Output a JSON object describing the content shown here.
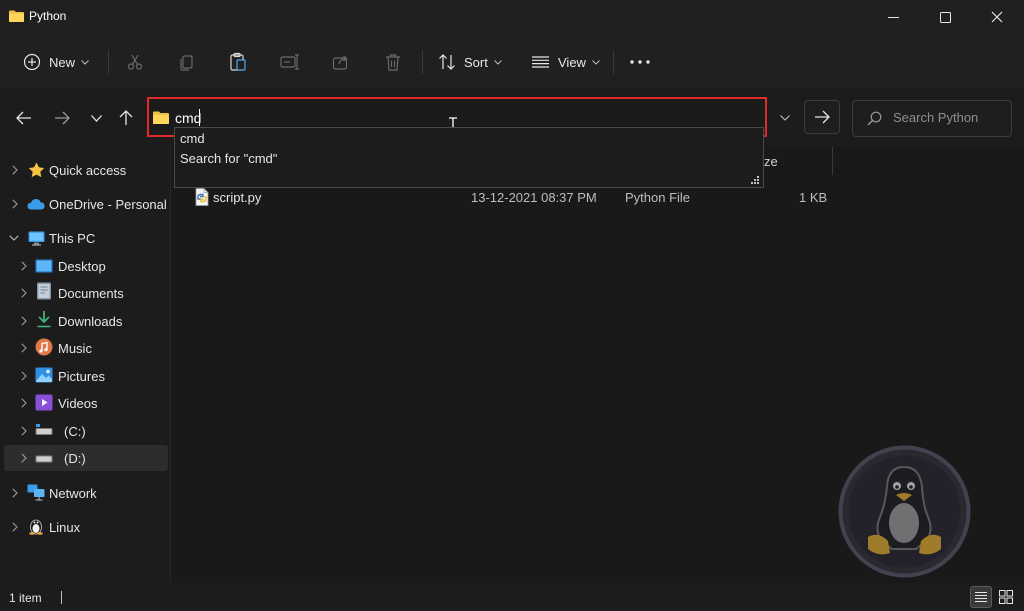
{
  "window": {
    "title": "Python"
  },
  "toolbar": {
    "new_label": "New",
    "sort_label": "Sort",
    "view_label": "View"
  },
  "address": {
    "value": "cmd"
  },
  "search": {
    "placeholder": "Search Python"
  },
  "suggestions": [
    "cmd",
    "Search for \"cmd\""
  ],
  "sidebar": {
    "items": [
      {
        "label": "Quick access",
        "icon": "star-icon"
      },
      {
        "label": "OneDrive - Personal",
        "icon": "cloud-icon"
      },
      {
        "label": "This PC",
        "icon": "computer-icon"
      },
      {
        "label": "Desktop",
        "icon": "desktop-icon"
      },
      {
        "label": "Documents",
        "icon": "documents-icon"
      },
      {
        "label": "Downloads",
        "icon": "download-icon"
      },
      {
        "label": "Music",
        "icon": "music-icon"
      },
      {
        "label": "Pictures",
        "icon": "pictures-icon"
      },
      {
        "label": "Videos",
        "icon": "videos-icon"
      },
      {
        "label": "(C:)",
        "icon": "drive-icon"
      },
      {
        "label": "(D:)",
        "icon": "drive-icon"
      },
      {
        "label": "Network",
        "icon": "network-icon"
      },
      {
        "label": "Linux",
        "icon": "linux-icon"
      }
    ]
  },
  "columns": {
    "size_header_partial": "ze"
  },
  "files": [
    {
      "name": "script.py",
      "date": "13-12-2021 08:37 PM",
      "type": "Python File",
      "size": "1 KB"
    }
  ],
  "status": {
    "item_count": "1 item"
  },
  "colors": {
    "highlight_border": "#e02a2a",
    "folder": "#f3c04c",
    "accent_blue": "#3a9be8"
  }
}
